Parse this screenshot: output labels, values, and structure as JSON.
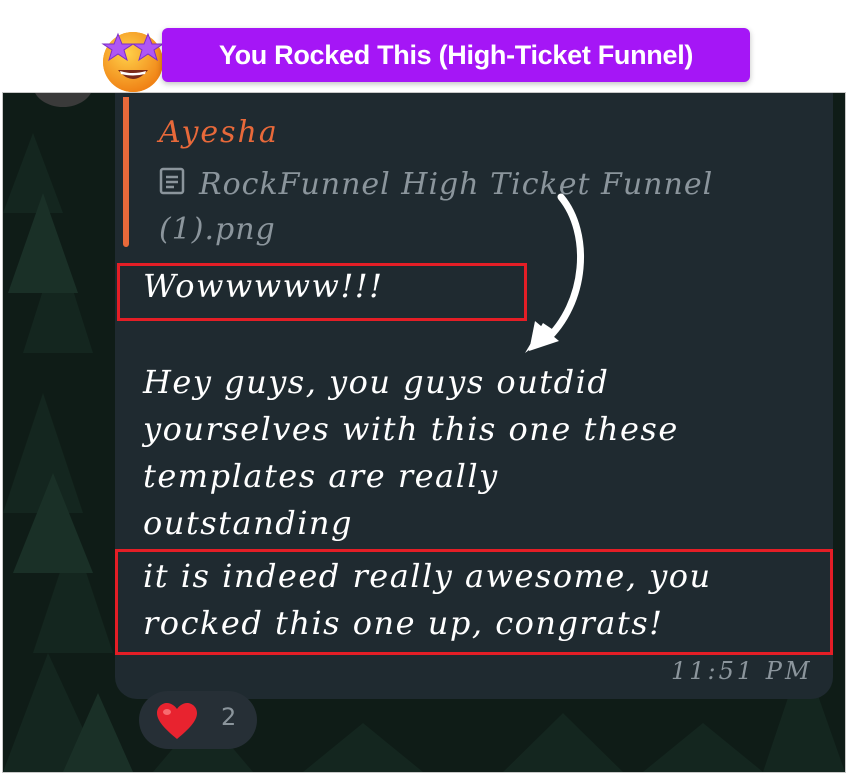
{
  "badge": {
    "title": "You Rocked This (High-Ticket Funnel)"
  },
  "reply": {
    "sender": "Ayesha",
    "file_name": "RockFunnel High Ticket Funnel (1).png"
  },
  "message": {
    "line1": "Wowwwww!!!",
    "paragraph": "Hey guys, you guys outdid yourselves with this one these templates are really outstanding",
    "closing": "it is indeed really awesome, you rocked this one up, congrats!",
    "time": "11:51 PM"
  },
  "reaction": {
    "emoji": "heart",
    "count": "2"
  },
  "colors": {
    "badge": "#a516f6",
    "highlight": "#e41e26",
    "reply_accent": "#e8693a",
    "bubble": "#1f2a30"
  }
}
